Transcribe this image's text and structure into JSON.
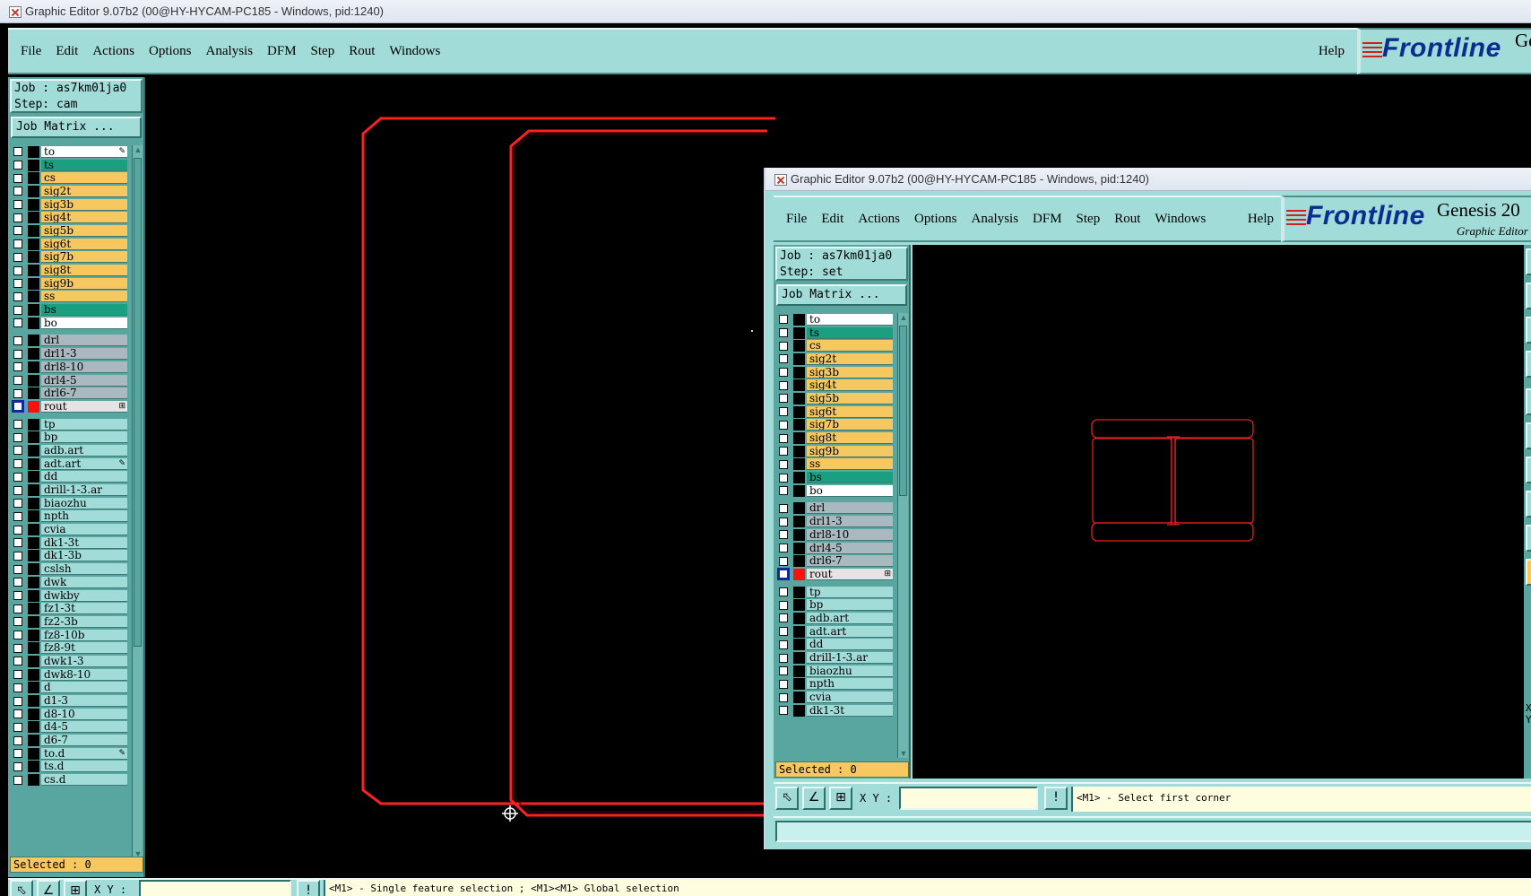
{
  "colors": {
    "accent": "#a1dcd9",
    "canvas": "#000000",
    "profile": "#ff2020",
    "frontline_blue": "#0b2d8f"
  },
  "main_window": {
    "title": "Graphic Editor 9.07b2 (00@HY-HYCAM-PC185 - Windows, pid:1240)",
    "menu": [
      "File",
      "Edit",
      "Actions",
      "Options",
      "Analysis",
      "DFM",
      "Step",
      "Rout",
      "Windows"
    ],
    "help": "Help",
    "logo": {
      "frontline": "Frontline",
      "genesis": "Ge"
    },
    "job": "Job : as7km01ja0",
    "step": "Step: cam",
    "job_matrix": "Job Matrix ...",
    "layers": [
      {
        "name": "to",
        "color": "white",
        "tag": "✎"
      },
      {
        "name": "ts",
        "color": "green"
      },
      {
        "name": "cs",
        "color": "orange"
      },
      {
        "name": "sig2t",
        "color": "orange"
      },
      {
        "name": "sig3b",
        "color": "orange"
      },
      {
        "name": "sig4t",
        "color": "orange"
      },
      {
        "name": "sig5b",
        "color": "orange"
      },
      {
        "name": "sig6t",
        "color": "orange"
      },
      {
        "name": "sig7b",
        "color": "orange"
      },
      {
        "name": "sig8t",
        "color": "orange"
      },
      {
        "name": "sig9b",
        "color": "orange"
      },
      {
        "name": "ss",
        "color": "orange"
      },
      {
        "name": "bs",
        "color": "green"
      },
      {
        "name": "bo",
        "color": "white"
      },
      {
        "gap": true
      },
      {
        "name": "drl",
        "color": "gray"
      },
      {
        "name": "drl1-3",
        "color": "gray"
      },
      {
        "name": "drl8-10",
        "color": "gray"
      },
      {
        "name": "drl4-5",
        "color": "gray"
      },
      {
        "name": "drl6-7",
        "color": "gray"
      },
      {
        "name": "rout",
        "color": "lgray",
        "active": true,
        "tag": "⊞"
      },
      {
        "gap": true
      },
      {
        "name": "tp",
        "color": "cyan"
      },
      {
        "name": "bp",
        "color": "cyan"
      },
      {
        "name": "adb.art",
        "color": "cyan"
      },
      {
        "name": "adt.art",
        "color": "cyan",
        "tag": "✎"
      },
      {
        "name": "dd",
        "color": "cyan"
      },
      {
        "name": "drill-1-3.ar",
        "color": "cyan"
      },
      {
        "name": "biaozhu",
        "color": "cyan"
      },
      {
        "name": "npth",
        "color": "cyan"
      },
      {
        "name": "cvia",
        "color": "cyan"
      },
      {
        "name": "dk1-3t",
        "color": "cyan"
      },
      {
        "name": "dk1-3b",
        "color": "cyan"
      },
      {
        "name": "cslsh",
        "color": "cyan"
      },
      {
        "name": "dwk",
        "color": "cyan"
      },
      {
        "name": "dwkby",
        "color": "cyan"
      },
      {
        "name": "fz1-3t",
        "color": "cyan"
      },
      {
        "name": "fz2-3b",
        "color": "cyan"
      },
      {
        "name": "fz8-10b",
        "color": "cyan"
      },
      {
        "name": "fz8-9t",
        "color": "cyan"
      },
      {
        "name": "dwk1-3",
        "color": "cyan"
      },
      {
        "name": "dwk8-10",
        "color": "cyan"
      },
      {
        "name": "d",
        "color": "cyan"
      },
      {
        "name": "d1-3",
        "color": "cyan"
      },
      {
        "name": "d8-10",
        "color": "cyan"
      },
      {
        "name": "d4-5",
        "color": "cyan"
      },
      {
        "name": "d6-7",
        "color": "cyan"
      },
      {
        "name": "to.d",
        "color": "cyan",
        "tag": "✎"
      },
      {
        "name": "ts.d",
        "color": "cyan"
      },
      {
        "name": "cs.d",
        "color": "cyan"
      }
    ],
    "selected": "Selected : 0",
    "xy_label": "X Y :",
    "prompt": "<M1> - Single feature selection ; <M1><M1> Global selection"
  },
  "second_window": {
    "title": "Graphic Editor 9.07b2 (00@HY-HYCAM-PC185 - Windows, pid:1240)",
    "menu": [
      "File",
      "Edit",
      "Actions",
      "Options",
      "Analysis",
      "DFM",
      "Step",
      "Rout",
      "Windows"
    ],
    "help": "Help",
    "logo": {
      "frontline": "Frontline",
      "genesis": "Genesis 20",
      "graphic_editor": "Graphic Editor"
    },
    "job": "Job : as7km01ja0",
    "step": "Step: set",
    "job_matrix": "Job Matrix ...",
    "layers": [
      {
        "name": "to",
        "color": "white"
      },
      {
        "name": "ts",
        "color": "green"
      },
      {
        "name": "cs",
        "color": "orange"
      },
      {
        "name": "sig2t",
        "color": "orange"
      },
      {
        "name": "sig3b",
        "color": "orange"
      },
      {
        "name": "sig4t",
        "color": "orange"
      },
      {
        "name": "sig5b",
        "color": "orange"
      },
      {
        "name": "sig6t",
        "color": "orange"
      },
      {
        "name": "sig7b",
        "color": "orange"
      },
      {
        "name": "sig8t",
        "color": "orange"
      },
      {
        "name": "sig9b",
        "color": "orange"
      },
      {
        "name": "ss",
        "color": "orange"
      },
      {
        "name": "bs",
        "color": "green"
      },
      {
        "name": "bo",
        "color": "white"
      },
      {
        "gap": true
      },
      {
        "name": "drl",
        "color": "gray"
      },
      {
        "name": "drl1-3",
        "color": "gray"
      },
      {
        "name": "drl8-10",
        "color": "gray"
      },
      {
        "name": "drl4-5",
        "color": "gray"
      },
      {
        "name": "drl6-7",
        "color": "gray"
      },
      {
        "name": "rout",
        "color": "lgray",
        "active": true,
        "tag": "⊞"
      },
      {
        "gap": true
      },
      {
        "name": "tp",
        "color": "cyan"
      },
      {
        "name": "bp",
        "color": "cyan"
      },
      {
        "name": "adb.art",
        "color": "cyan"
      },
      {
        "name": "adt.art",
        "color": "cyan"
      },
      {
        "name": "dd",
        "color": "cyan"
      },
      {
        "name": "drill-1-3.ar",
        "color": "cyan"
      },
      {
        "name": "biaozhu",
        "color": "cyan"
      },
      {
        "name": "npth",
        "color": "cyan"
      },
      {
        "name": "cvia",
        "color": "cyan"
      },
      {
        "name": "dk1-3t",
        "color": "cyan"
      }
    ],
    "selected": "Selected : 0",
    "xy_label": "X Y :",
    "prompt": "<M1> - Select first corner",
    "coord_labels": [
      "X =",
      "Y ="
    ]
  }
}
